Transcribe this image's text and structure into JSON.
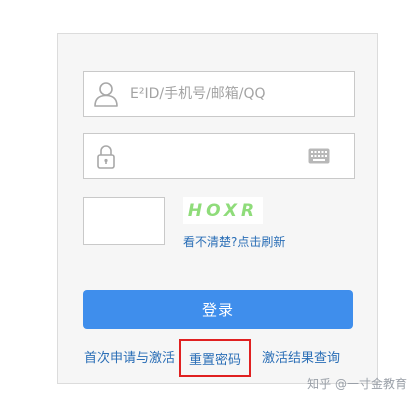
{
  "login_form": {
    "account_placeholder": "E²ID/手机号/邮箱/QQ",
    "account_value": "",
    "password_placeholder": "",
    "password_value": "",
    "captcha_value": "",
    "captcha_image_text": "HOXR",
    "refresh_link": "看不清楚?点击刷新",
    "login_button": "登录"
  },
  "footer_links": {
    "first_application": "首次申请与激活",
    "reset_password": "重置密码",
    "activation_result": "激活结果查询"
  },
  "watermark": "知乎 @一寸金教育",
  "colors": {
    "primary_button": "#3f8eec",
    "link": "#2a6eb6",
    "highlight_border": "#e02020",
    "captcha_text": "#8fdc7a"
  },
  "icons": {
    "account": "user-icon",
    "password": "lock-icon",
    "keyboard": "keyboard-icon"
  }
}
